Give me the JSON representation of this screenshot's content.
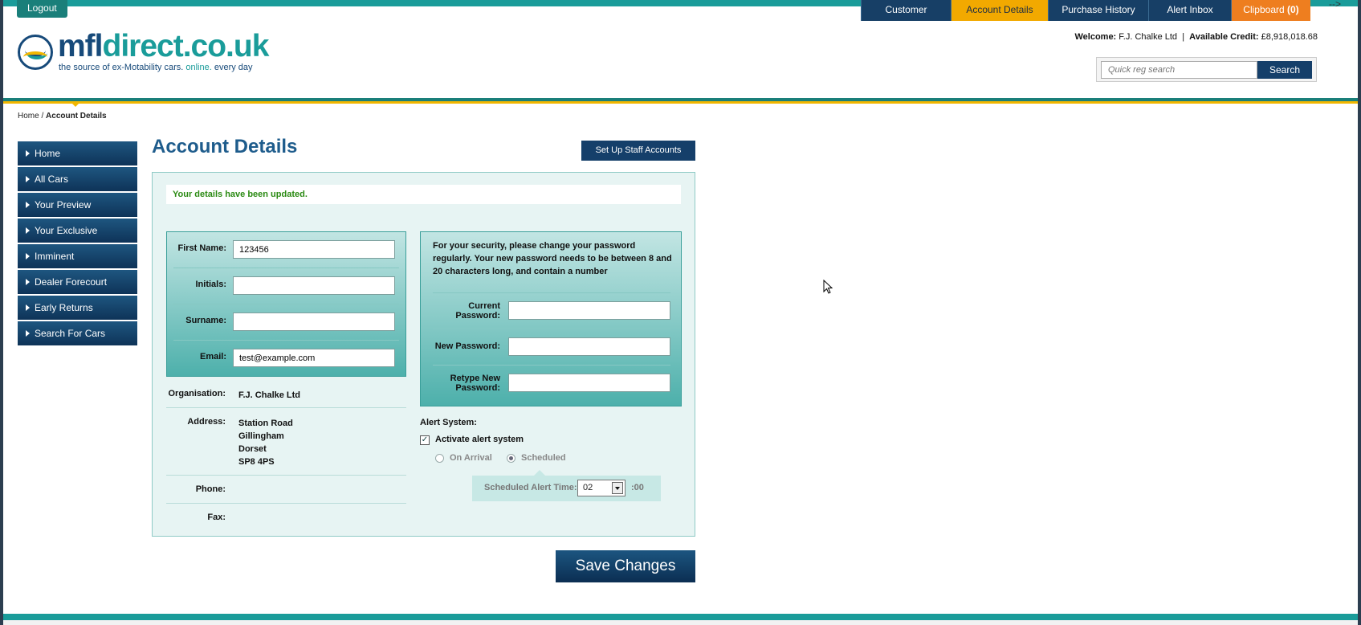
{
  "topbar": {
    "logout_label": "Logout",
    "nav": [
      {
        "label": "Customer Support"
      },
      {
        "label": "Account Details"
      },
      {
        "label": "Purchase History"
      },
      {
        "label": "Alert Inbox"
      },
      {
        "label": "Clipboard",
        "count": "(0)"
      }
    ],
    "corner_arrow": "-->"
  },
  "logo": {
    "brand_part1": "mfl",
    "brand_part2": "direct.co.uk",
    "tagline_part1": "the source of ex-Motability cars.",
    "tagline_part2": "online.",
    "tagline_part3": "every day"
  },
  "account": {
    "welcome_label": "Welcome:",
    "company": "F.J. Chalke Ltd",
    "separator": "|",
    "credit_label": "Available Credit:",
    "credit_value": "£8,918,018.68"
  },
  "search": {
    "placeholder": "Quick reg search",
    "button_label": "Search"
  },
  "breadcrumb": {
    "home": "Home",
    "separator": "/",
    "current": "Account Details"
  },
  "sidebar": {
    "items": [
      {
        "label": "Home"
      },
      {
        "label": "All Cars"
      },
      {
        "label": "Your Preview"
      },
      {
        "label": "Your Exclusive"
      },
      {
        "label": "Imminent"
      },
      {
        "label": "Dealer Forecourt"
      },
      {
        "label": "Early Returns"
      },
      {
        "label": "Search For Cars"
      }
    ]
  },
  "page": {
    "title": "Account Details",
    "staff_button": "Set Up Staff Accounts",
    "success_message": "Your details have been updated.",
    "save_button": "Save Changes"
  },
  "form": {
    "first_name_label": "First Name:",
    "first_name_value": "123456",
    "initials_label": "Initials:",
    "initials_value": "",
    "surname_label": "Surname:",
    "surname_value": "",
    "email_label": "Email:",
    "email_value": "test@example.com"
  },
  "details": {
    "organisation_label": "Organisation:",
    "organisation_value": "F.J. Chalke Ltd",
    "address_label": "Address:",
    "address_lines": [
      "Station Road",
      "Gillingham",
      "Dorset",
      "SP8 4PS"
    ],
    "phone_label": "Phone:",
    "fax_label": "Fax:"
  },
  "password": {
    "security_note": "For your security, please change your password regularly. Your new password needs to be between 8 and 20 characters long, and contain a number",
    "current_label_1": "Current",
    "current_label_2": "Password:",
    "new_label": "New Password:",
    "retype_label_1": "Retype New",
    "retype_label_2": "Password:"
  },
  "alerts": {
    "system_label": "Alert System:",
    "activate_label": "Activate alert system",
    "activate_checked": true,
    "on_arrival_label": "On Arrival",
    "scheduled_label": "Scheduled",
    "selected_mode": "Scheduled",
    "time_label": "Scheduled Alert Time:",
    "time_value": "02",
    "time_suffix": ":00"
  },
  "colors": {
    "navy": "#153f6a",
    "teal": "#1a9c9a",
    "gold": "#f2a900",
    "orange": "#ee7e1f",
    "success_green": "#2a8a12"
  }
}
